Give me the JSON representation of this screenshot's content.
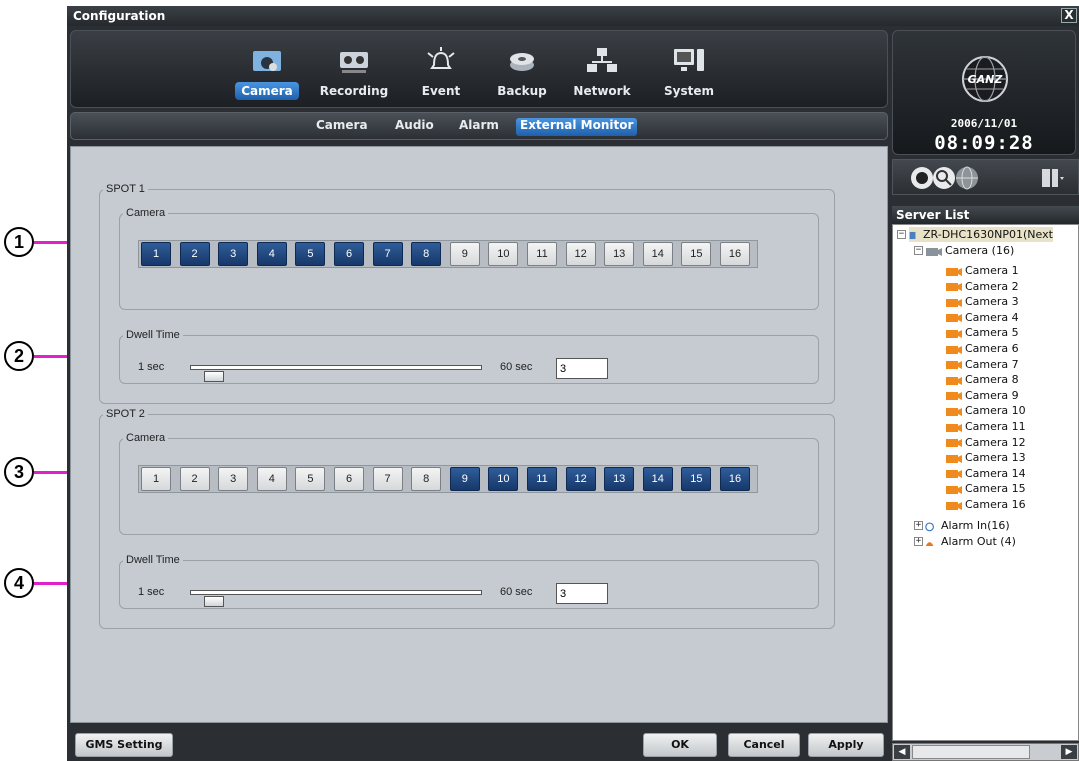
{
  "window": {
    "title": "Configuration",
    "close_label": "X"
  },
  "main_tabs": [
    {
      "label": "Camera",
      "icon": "camera-icon",
      "active": true
    },
    {
      "label": "Recording",
      "icon": "recorder-icon",
      "active": false
    },
    {
      "label": "Event",
      "icon": "alarm-bell-icon",
      "active": false
    },
    {
      "label": "Backup",
      "icon": "disk-icon",
      "active": false
    },
    {
      "label": "Network",
      "icon": "network-icon",
      "active": false
    },
    {
      "label": "System",
      "icon": "monitor-icon",
      "active": false
    }
  ],
  "sub_tabs": [
    {
      "label": "Camera",
      "active": false
    },
    {
      "label": "Audio",
      "active": false
    },
    {
      "label": "Alarm",
      "active": false
    },
    {
      "label": "External Monitor",
      "active": true
    }
  ],
  "callouts": [
    "1",
    "2",
    "3",
    "4"
  ],
  "spots": [
    {
      "title": "SPOT 1",
      "camera_legend": "Camera",
      "buttons": [
        "1",
        "2",
        "3",
        "4",
        "5",
        "6",
        "7",
        "8",
        "9",
        "10",
        "11",
        "12",
        "13",
        "14",
        "15",
        "16"
      ],
      "selected": [
        "1",
        "2",
        "3",
        "4",
        "5",
        "6",
        "7",
        "8"
      ],
      "dwell_legend": "Dwell Time",
      "dwell_min": "1 sec",
      "dwell_max": "60 sec",
      "dwell_value": "3",
      "dwell_level": 0.034
    },
    {
      "title": "SPOT 2",
      "camera_legend": "Camera",
      "buttons": [
        "1",
        "2",
        "3",
        "4",
        "5",
        "6",
        "7",
        "8",
        "9",
        "10",
        "11",
        "12",
        "13",
        "14",
        "15",
        "16"
      ],
      "selected": [
        "9",
        "10",
        "11",
        "12",
        "13",
        "14",
        "15",
        "16"
      ],
      "dwell_legend": "Dwell Time",
      "dwell_min": "1 sec",
      "dwell_max": "60 sec",
      "dwell_value": "3",
      "dwell_level": 0.034
    }
  ],
  "bottom": {
    "gms_label": "GMS Setting",
    "ok_label": "OK",
    "cancel_label": "Cancel",
    "apply_label": "Apply"
  },
  "brand": {
    "logo_text": "GANZ",
    "date": "2006/11/01",
    "time": "08:09:28"
  },
  "tools": [
    "camera-tool-icon",
    "search-tool-icon",
    "globe-tool-icon",
    "device-list-icon"
  ],
  "server_list": {
    "title": "Server List",
    "server": "ZR-DHC1630NP01(Next",
    "camera_group": "Camera (16)",
    "cameras": [
      "Camera 1",
      "Camera 2",
      "Camera 3",
      "Camera 4",
      "Camera 5",
      "Camera 6",
      "Camera 7",
      "Camera 8",
      "Camera 9",
      "Camera 10",
      "Camera 11",
      "Camera 12",
      "Camera 13",
      "Camera 14",
      "Camera 15",
      "Camera 16"
    ],
    "alarm_in": "Alarm In(16)",
    "alarm_out": "Alarm Out (4)"
  },
  "colors": {
    "accent": "#2f6fbd",
    "selected_button": "#1f4678",
    "callout_line": "#e020c8"
  }
}
